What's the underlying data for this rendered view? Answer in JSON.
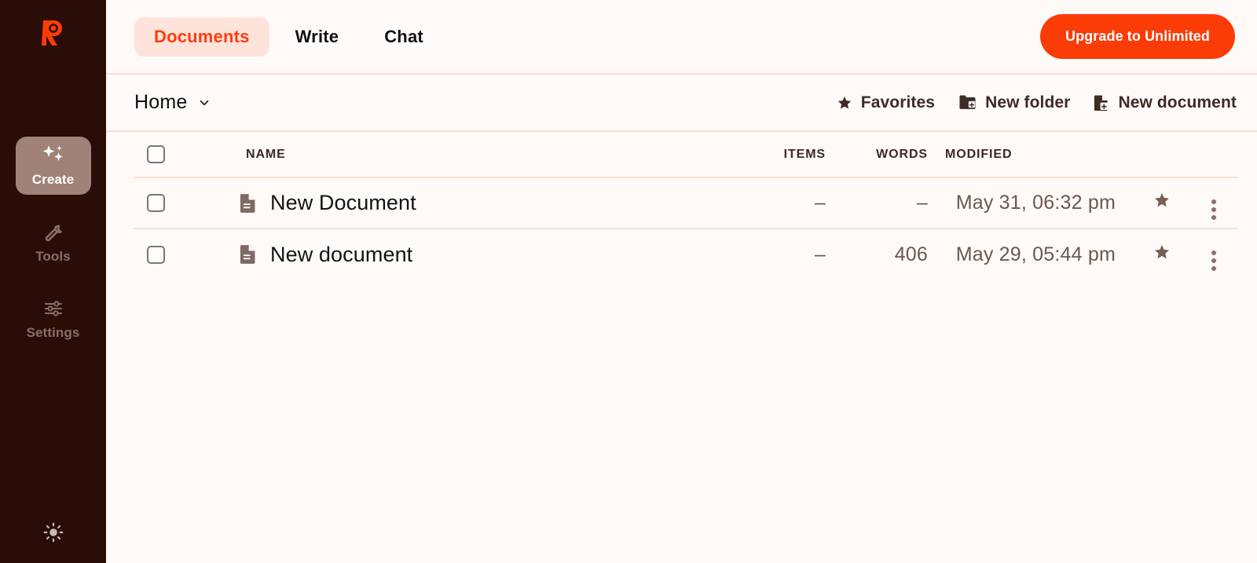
{
  "brand": {
    "logo_icon": "rytr-r-logo-icon",
    "accent_color": "#fb3c06",
    "sidebar_color": "#2a0d06",
    "active_pill_color": "#a08279",
    "tab_pill_color": "#ffe3da",
    "divider_color": "#fadcd2",
    "background_color": "#fdfaf8"
  },
  "sidebar": {
    "items": [
      {
        "label": "Create",
        "icon": "sparkles-icon",
        "active": true
      },
      {
        "label": "Tools",
        "icon": "wrench-icon",
        "active": false
      },
      {
        "label": "Settings",
        "icon": "sliders-icon",
        "active": false
      }
    ],
    "theme_toggle": {
      "icon": "sun-icon",
      "label": "Toggle theme"
    }
  },
  "topbar": {
    "tabs": [
      {
        "label": "Documents",
        "active": true
      },
      {
        "label": "Write",
        "active": false
      },
      {
        "label": "Chat",
        "active": false
      }
    ],
    "upgrade_button": "Upgrade to Unlimited"
  },
  "toolbar": {
    "breadcrumb": "Home",
    "breadcrumb_icon": "chevron-down-icon",
    "actions": [
      {
        "label": "Favorites",
        "icon": "star-icon"
      },
      {
        "label": "New folder",
        "icon": "folder-plus-icon"
      },
      {
        "label": "New document",
        "icon": "file-plus-icon"
      }
    ]
  },
  "table": {
    "select_all_checkbox": false,
    "columns": {
      "name": "NAME",
      "items": "ITEMS",
      "words": "WORDS",
      "modified": "MODIFIED"
    },
    "rows": [
      {
        "name": "New Document",
        "icon": "document-icon",
        "items": "–",
        "words": "–",
        "modified": "May 31, 06:32 pm",
        "favorite": true,
        "checked": false
      },
      {
        "name": "New document",
        "icon": "document-icon",
        "items": "–",
        "words": "406",
        "modified": "May 29, 05:44 pm",
        "favorite": true,
        "checked": false
      }
    ]
  }
}
